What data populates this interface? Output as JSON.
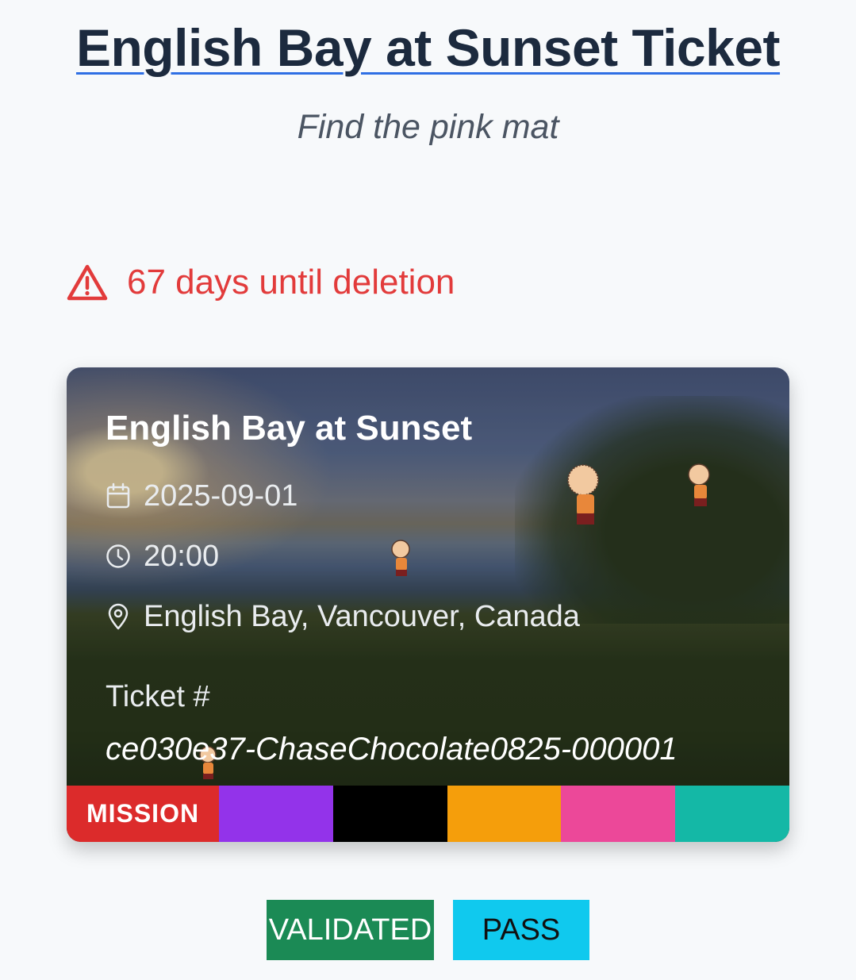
{
  "header": {
    "title": "English Bay at Sunset Ticket",
    "subtitle": "Find the pink mat"
  },
  "warning": {
    "text": "67 days until deletion",
    "icon": "warning-triangle-icon",
    "color": "#e23b3b"
  },
  "ticket": {
    "event_title": "English Bay at Sunset",
    "date": "2025-09-01",
    "time": "20:00",
    "location": "English Bay, Vancouver, Canada",
    "ticket_label": "Ticket #",
    "ticket_number": "ce030e37-ChaseChocolate0825-000001",
    "icons": [
      "calendar-icon",
      "clock-icon",
      "location-pin-icon"
    ]
  },
  "color_bar": {
    "label": "MISSION",
    "label_color": "#dc2b2b",
    "swatches": [
      "#9333ea",
      "#000000",
      "#f59e0b",
      "#ec4899",
      "#14b8a6"
    ]
  },
  "status": {
    "validated": "VALIDATED",
    "validated_color": "#1b8a55",
    "pass": "PASS",
    "pass_color": "#10c9ee"
  }
}
